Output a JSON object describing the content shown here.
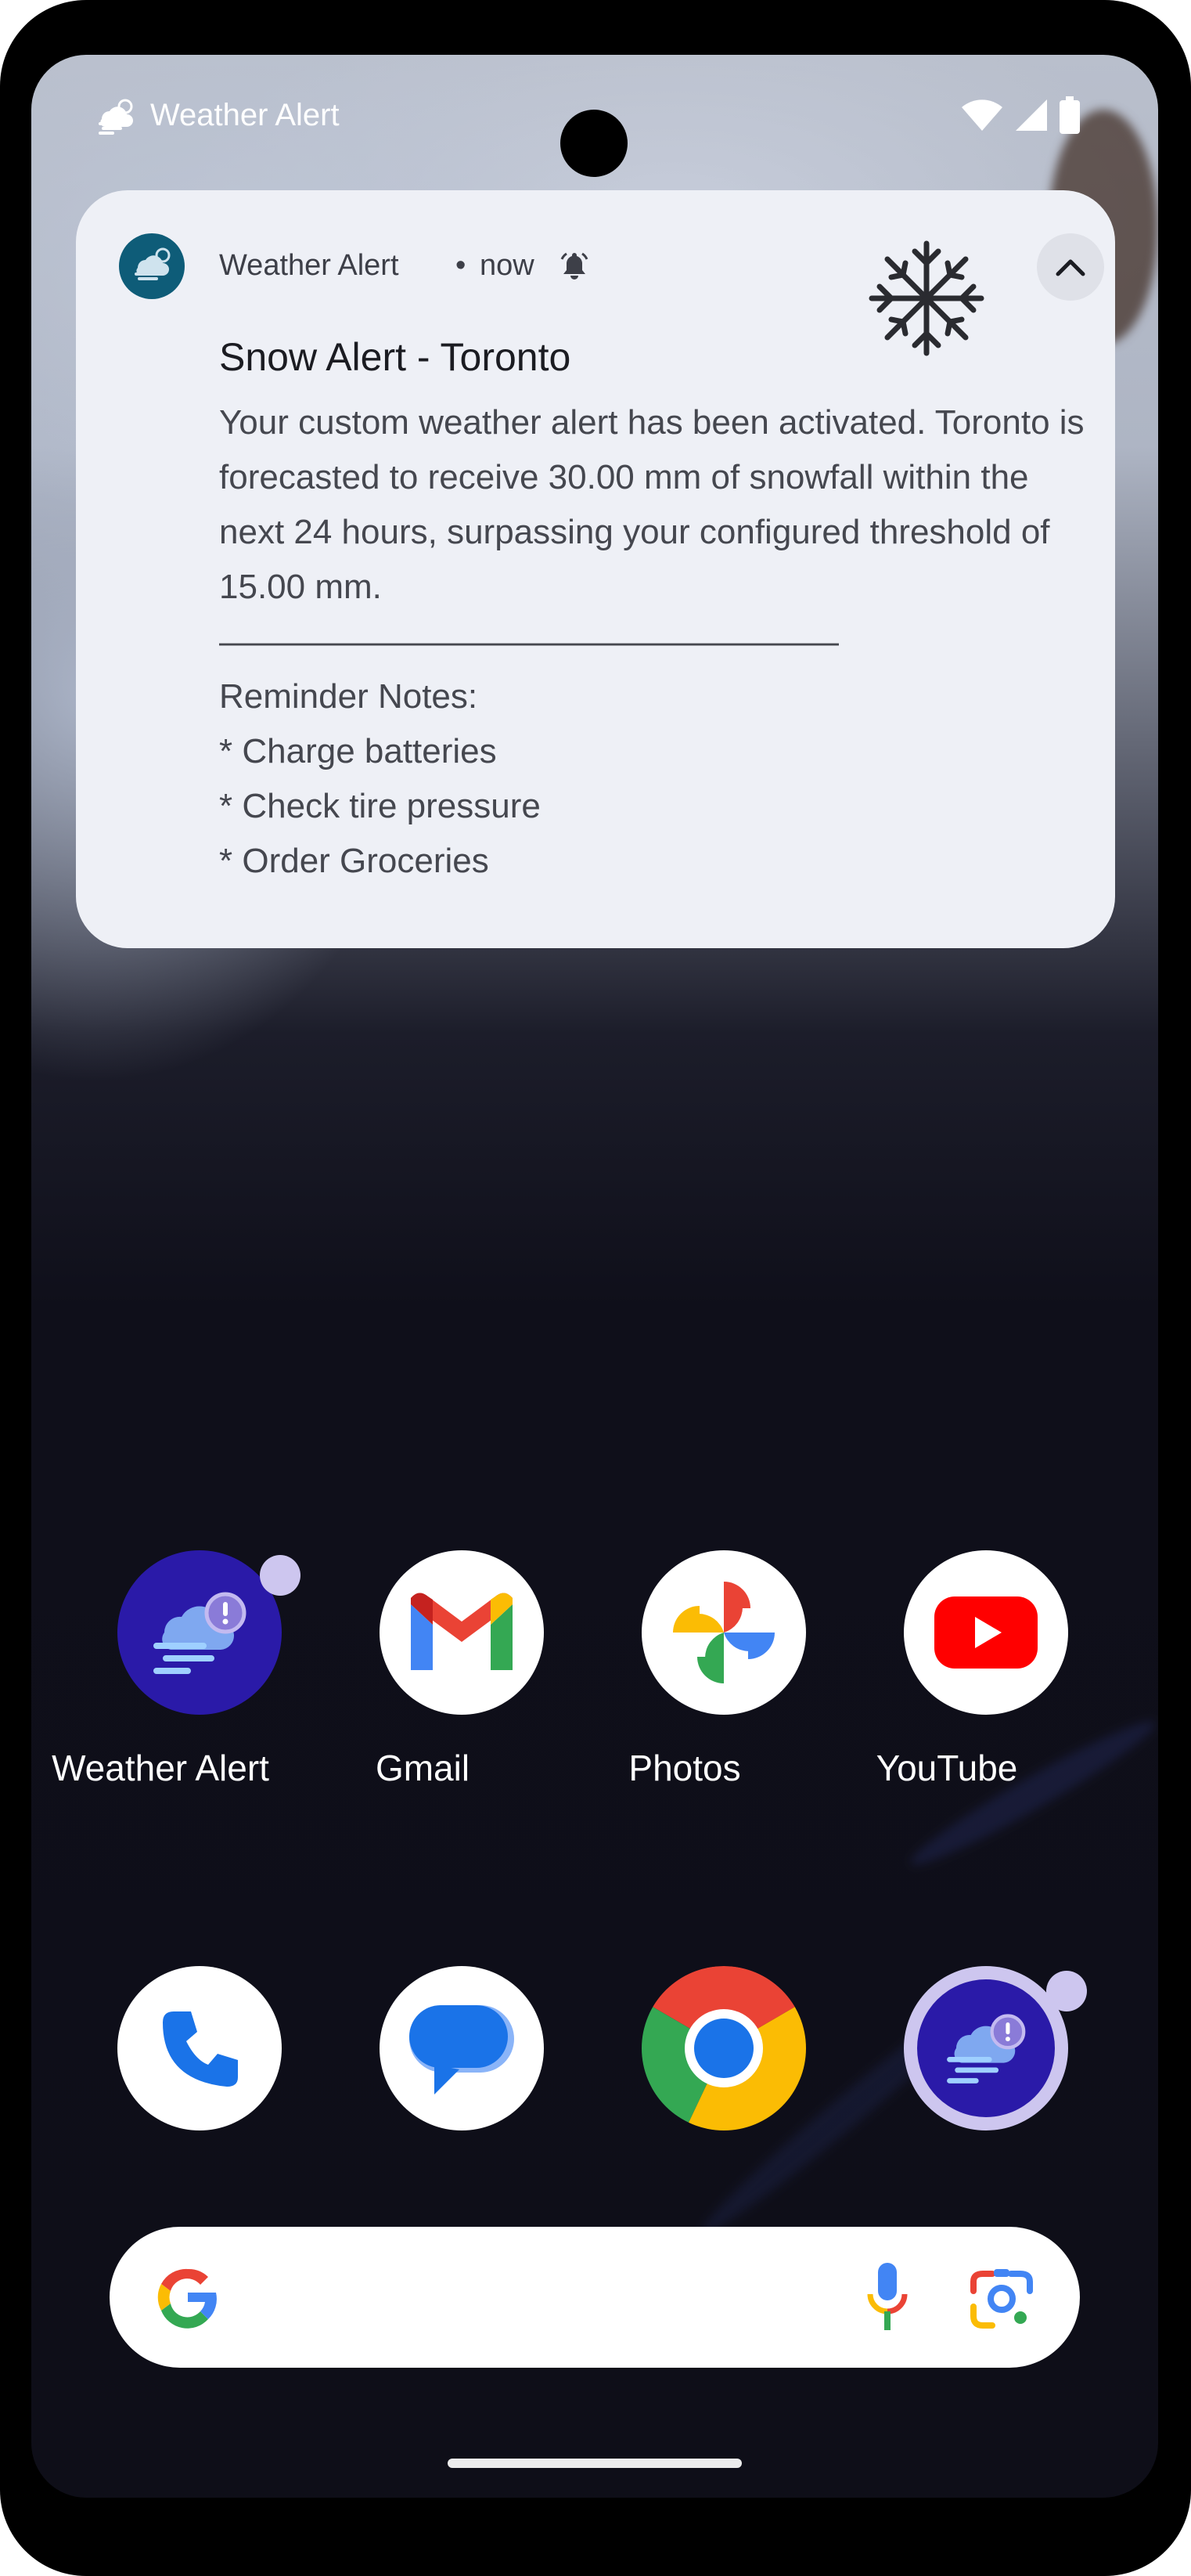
{
  "status_bar": {
    "app_title": "Weather Alert",
    "icons": [
      "weather-alert-icon",
      "wifi-icon",
      "signal-icon",
      "battery-icon"
    ]
  },
  "notification": {
    "app_name": "Weather Alert",
    "separator": "•",
    "time": "now",
    "title": "Snow Alert - Toronto",
    "body": "Your custom weather alert has been activated. Toronto is forecasted to receive 30.00 mm of snowfall within the next 24 hours, surpassing your configured threshold of 15.00 mm.\n——————————————————\nReminder Notes:\n* Charge batteries\n* Check tire pressure\n* Order Groceries",
    "icons": [
      "weather-alert-icon",
      "bell-icon",
      "snowflake-icon",
      "collapse-chevron-icon"
    ]
  },
  "home": {
    "row1": [
      {
        "label": "Weather Alert",
        "icon": "weather-alert-app-icon"
      },
      {
        "label": "Gmail",
        "icon": "gmail-icon"
      },
      {
        "label": "Photos",
        "icon": "photos-icon"
      },
      {
        "label": "YouTube",
        "icon": "youtube-icon"
      }
    ],
    "dock": [
      {
        "icon": "phone-icon"
      },
      {
        "icon": "messages-icon"
      },
      {
        "icon": "chrome-icon"
      },
      {
        "icon": "weather-alert-app-icon"
      }
    ]
  },
  "search_bar": {
    "icons": [
      "google-g-icon",
      "microphone-icon",
      "lens-icon"
    ]
  },
  "colors": {
    "notification_bg": "#eef0f6",
    "weather_app_bg": "#2a1aa8",
    "notification_icon_bg": "#0e5c78"
  }
}
